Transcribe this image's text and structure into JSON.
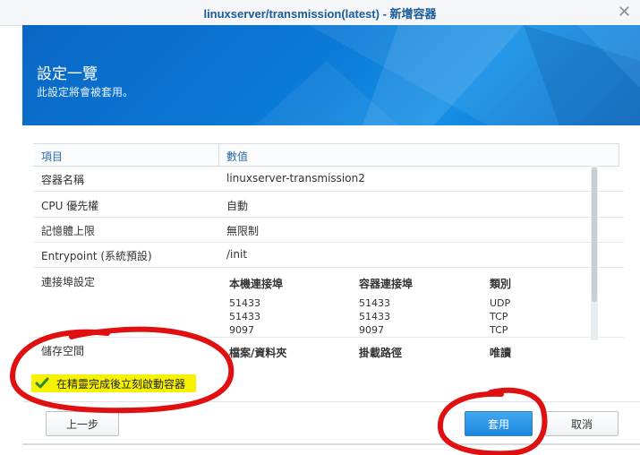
{
  "window": {
    "title": "linuxserver/transmission(latest) - 新增容器"
  },
  "banner": {
    "title": "設定一覽",
    "subtitle": "此設定將會被套用。"
  },
  "table": {
    "headers": [
      "項目",
      "數值"
    ],
    "rows": [
      {
        "key": "容器名稱",
        "value": "linuxserver-transmission2"
      },
      {
        "key": "CPU 優先權",
        "value": "自動"
      },
      {
        "key": "記憶體上限",
        "value": "無限制"
      },
      {
        "key": "Entrypoint (系統預設)",
        "value": "/init"
      }
    ],
    "ports": {
      "label": "連接埠設定",
      "headers": [
        "本機連接埠",
        "容器連接埠",
        "類別"
      ],
      "rows": [
        [
          "51433",
          "51433",
          "UDP"
        ],
        [
          "51433",
          "51433",
          "TCP"
        ],
        [
          "9097",
          "9097",
          "TCP"
        ]
      ]
    },
    "storage": {
      "label": "儲存空間",
      "headers": [
        "檔案/資料夾",
        "掛載路徑",
        "唯讀"
      ]
    }
  },
  "checkbox": {
    "label": "在精靈完成後立刻啟動容器",
    "checked": true
  },
  "buttons": {
    "back": "上一步",
    "apply": "套用",
    "cancel": "取消"
  },
  "colors": {
    "accent": "#0b79d6",
    "annotation": "#e01010",
    "highlight": "#f7f200"
  }
}
